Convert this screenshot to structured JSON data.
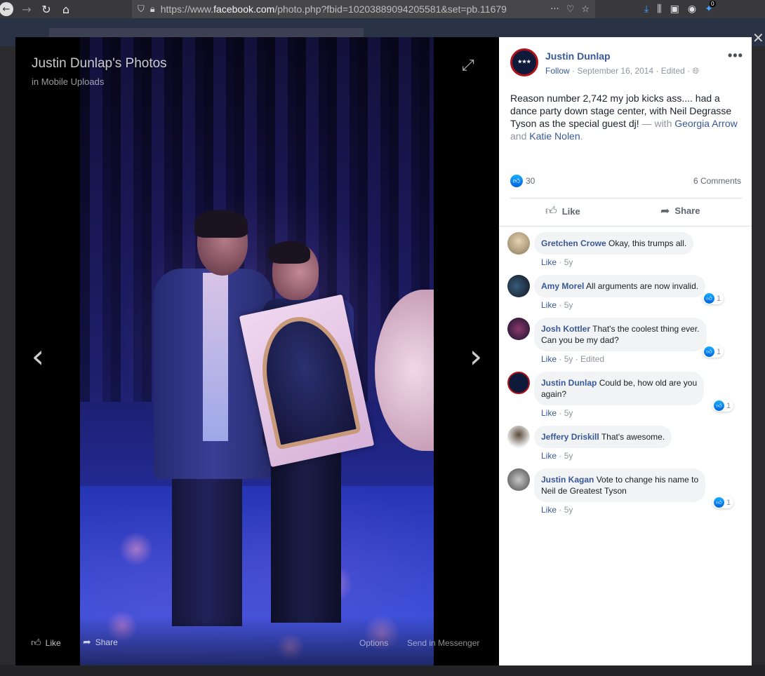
{
  "browser": {
    "url_prefix": "https://www.",
    "url_domain": "facebook.com",
    "url_rest": "/photo.php?fbid=10203889094205581&set=pb.11679",
    "extension_badge": "0"
  },
  "theater": {
    "title": "Justin Dunlap's Photos",
    "subtitle": "in Mobile Uploads",
    "like_label": "Like",
    "share_label": "Share",
    "options_label": "Options",
    "messenger_label": "Send in Messenger"
  },
  "post": {
    "author": "Justin Dunlap",
    "follow_label": "Follow",
    "date": "September 16, 2014",
    "edited": "Edited",
    "text": "Reason number 2,742 my job kicks ass.... had a dance party down stage center, with Neil Degrasse Tyson as the special guest dj!",
    "with_label": "— with",
    "tag1": "Georgia Arrow",
    "and_label": "and",
    "tag2": "Katie Nolen",
    "reaction_count": "30",
    "comment_count": "6 Comments",
    "like_action": "Like",
    "share_action": "Share"
  },
  "comments": [
    {
      "name": "Gretchen Crowe",
      "text": "Okay, this trumps all.",
      "like": "Like",
      "time": "5y",
      "extra": "",
      "reactions": ""
    },
    {
      "name": "Amy Morel",
      "text": "All arguments are now invalid.",
      "like": "Like",
      "time": "5y",
      "extra": "",
      "reactions": "1"
    },
    {
      "name": "Josh Kottler",
      "text": "That's the coolest thing ever.",
      "text2": "Can you be my dad?",
      "like": "Like",
      "time": "5y",
      "extra": "Edited",
      "reactions": "1"
    },
    {
      "name": "Justin Dunlap",
      "text": "Could be, how old are you",
      "text2": "again?",
      "like": "Like",
      "time": "5y",
      "extra": "",
      "reactions": "1"
    },
    {
      "name": "Jeffery Driskill",
      "text": "That's awesome.",
      "like": "Like",
      "time": "5y",
      "extra": "",
      "reactions": ""
    },
    {
      "name": "Justin Kagan",
      "text": "Vote to change his name to",
      "text2": "Neil de Greatest Tyson",
      "like": "Like",
      "time": "5y",
      "extra": "",
      "reactions": "1"
    }
  ],
  "colors": {
    "link": "#385898",
    "meta": "#90949c",
    "bubble": "#f2f3f5",
    "like_blue": "#1877f2"
  },
  "icons": [
    "back-icon",
    "forward-icon",
    "reload-icon",
    "home-icon",
    "shield-icon",
    "lock-icon",
    "more-icon",
    "pocket-icon",
    "star-icon",
    "download-icon",
    "library-icon",
    "sidebar-icon",
    "account-icon",
    "extension-icon",
    "expand-icon",
    "chevron-left-icon",
    "chevron-right-icon",
    "thumbs-up-icon",
    "share-icon",
    "close-icon"
  ]
}
